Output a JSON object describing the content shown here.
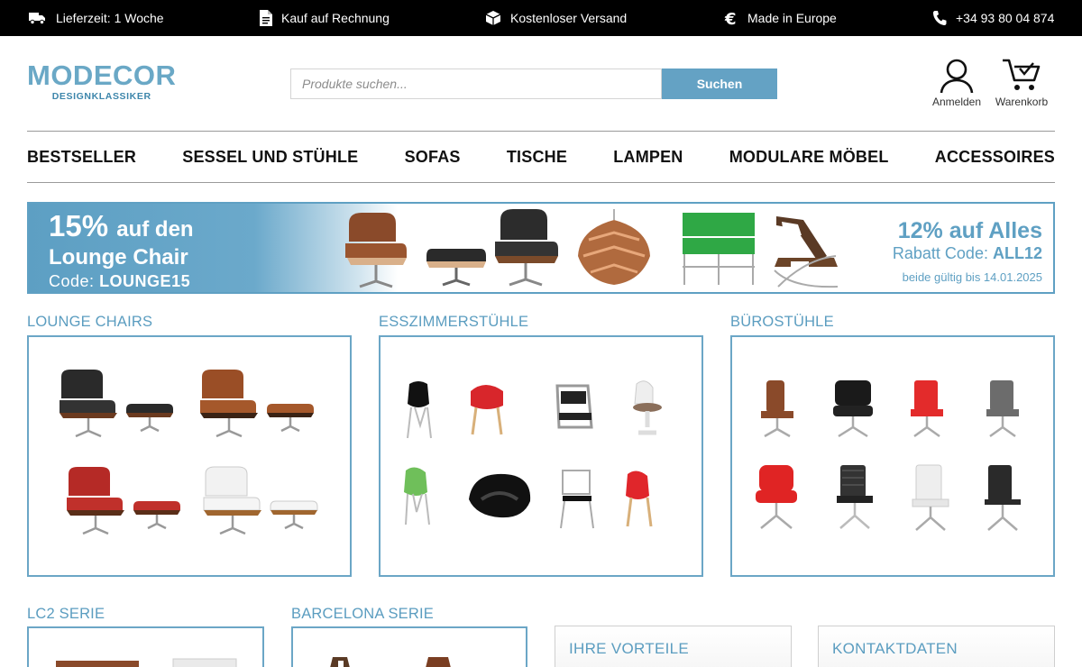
{
  "topbar": {
    "items": [
      {
        "icon": "truck-icon",
        "label": "Lieferzeit: 1 Woche"
      },
      {
        "icon": "document-icon",
        "label": "Kauf auf Rechnung"
      },
      {
        "icon": "package-icon",
        "label": "Kostenloser Versand"
      },
      {
        "icon": "euro-icon",
        "label": "Made in Europe"
      },
      {
        "icon": "phone-icon",
        "label": "+34 93 80 04 874"
      }
    ]
  },
  "header": {
    "logo": {
      "name": "MODECOR",
      "tagline": "DESIGNKLASSIKER"
    },
    "search": {
      "placeholder": "Produkte suchen...",
      "button": "Suchen"
    },
    "account_label": "Anmelden",
    "cart_label": "Warenkorb"
  },
  "nav": {
    "items": [
      "BESTSELLER",
      "SESSEL UND STÜHLE",
      "SOFAS",
      "TISCHE",
      "LAMPEN",
      "MODULARE MÖBEL",
      "ACCESSOIRES"
    ]
  },
  "banner": {
    "left_pct": "15%",
    "left_line1_rest": "auf den",
    "left_line2": "Lounge Chair",
    "left_code_label": "Code:",
    "left_code": "LOUNGE15",
    "right_line1": "12% auf Alles",
    "right_code_label": "Rabatt Code:",
    "right_code": "ALL12",
    "right_validity": "beide gültig bis 14.01.2025"
  },
  "categories": [
    {
      "title": "LOUNGE CHAIRS"
    },
    {
      "title": "ESSZIMMERSTÜHLE"
    },
    {
      "title": "BÜROSTÜHLE"
    },
    {
      "title": "LC2 SERIE"
    },
    {
      "title": "BARCELONA SERIE"
    }
  ],
  "info": {
    "advantages_title": "IHRE VORTEILE",
    "contact_title": "KONTAKTDATEN"
  },
  "colors": {
    "accent": "#5b9dc0",
    "topbar_bg": "#000000",
    "search_button": "#64a2c4"
  }
}
